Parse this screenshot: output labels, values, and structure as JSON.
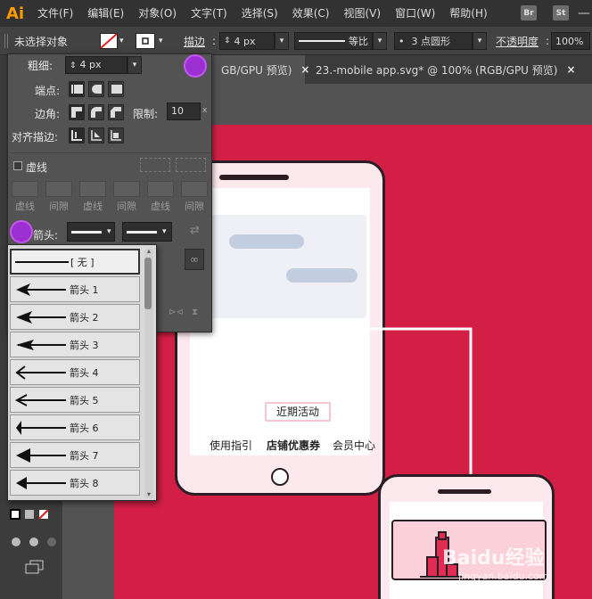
{
  "app": {
    "logo": "Ai",
    "badges": [
      "Br",
      "St"
    ],
    "accent": "#ff9a00"
  },
  "menu": [
    "文件(F)",
    "编辑(E)",
    "对象(O)",
    "文字(T)",
    "选择(S)",
    "效果(C)",
    "视图(V)",
    "窗口(W)",
    "帮助(H)"
  ],
  "window_controls": {
    "minimize": "—",
    "maximize": "□"
  },
  "control_bar": {
    "selection": "未选择对象",
    "stroke_label": "描边",
    "stroke_weight": "4 px",
    "profile": "等比",
    "brush": "3 点圆形",
    "opacity_label": "不透明度",
    "opacity": "100%"
  },
  "tabs": [
    {
      "label": "GB/GPU 预览)",
      "close": "×"
    },
    {
      "label": "23.-mobile app.svg* @ 100% (RGB/GPU 预览)",
      "close": "×"
    }
  ],
  "stroke_panel": {
    "weight_label": "粗细",
    "weight_value": "4 px",
    "cap_label": "端点",
    "corner_label": "边角",
    "limit_label": "限制",
    "limit_value": "10",
    "limit_unit": "x",
    "align_label": "对齐描边",
    "dashed_label": "虚线",
    "dash_labels": [
      "虚线",
      "间隙",
      "虚线",
      "间隙",
      "虚线",
      "间隙"
    ],
    "arrow_label": "箭头"
  },
  "arrow_list": [
    "[ 无 ]",
    "箭头 1",
    "箭头 2",
    "箭头 3",
    "箭头 4",
    "箭头 5",
    "箭头 6",
    "箭头 7",
    "箭头 8"
  ],
  "canvas": {
    "background": "#d31f46",
    "phone_button_label": "近期活动",
    "phone_tabs": [
      "使用指引",
      "店铺优惠券",
      "会员中心"
    ]
  },
  "watermark": {
    "brand": "Baidu经验",
    "url": "jingyan.baidu.com"
  }
}
